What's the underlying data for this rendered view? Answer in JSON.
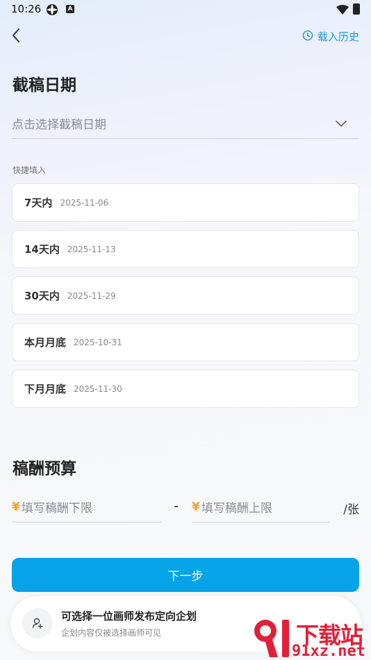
{
  "status_bar": {
    "time": "10:26",
    "notif_badge": "A"
  },
  "header": {
    "history_label": "载入历史"
  },
  "deadline": {
    "title": "截稿日期",
    "placeholder": "点击选择截稿日期",
    "quick_label": "快捷填入",
    "options": [
      {
        "name": "7天内",
        "date": "2025-11-06"
      },
      {
        "name": "14天内",
        "date": "2025-11-13"
      },
      {
        "name": "30天内",
        "date": "2025-11-29"
      },
      {
        "name": "本月月底",
        "date": "2025-10-31"
      },
      {
        "name": "下月月底",
        "date": "2025-11-30"
      }
    ]
  },
  "budget": {
    "title": "稿酬预算",
    "currency_symbol": "¥",
    "min_placeholder": "填写稿酬下限",
    "max_placeholder": "填写稿酬上限",
    "separator": "-",
    "unit": "/张"
  },
  "next_button": {
    "label": "下一步"
  },
  "tip": {
    "title": "可选择一位画师发布定向企划",
    "subtitle": "企划内容仅被选择画师可见"
  },
  "watermark": {
    "brand_text": "下载站",
    "domain_text": "91xz.net"
  },
  "colors": {
    "accent": "#06a3e8",
    "link": "#1a9bd8",
    "currency": "#f3a31f",
    "watermark": "#e0203a"
  }
}
